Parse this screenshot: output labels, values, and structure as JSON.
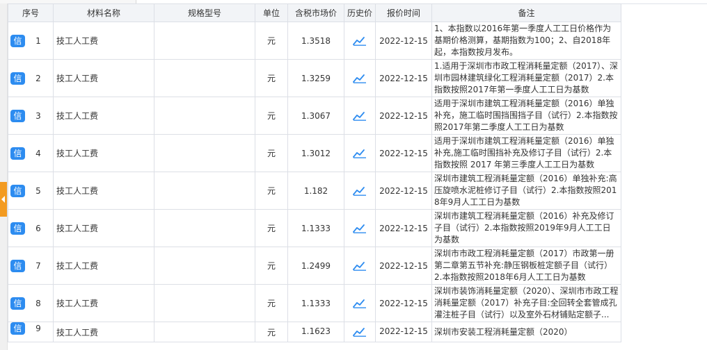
{
  "columns": [
    "序号",
    "材料名称",
    "规格型号",
    "单位",
    "含税市场价",
    "历史价",
    "报价时间",
    "备注"
  ],
  "badge_label": "信",
  "icon_color": "#2d8cf0",
  "rows": [
    {
      "seq": "1",
      "name": "技工人工费",
      "spec": "",
      "unit": "元",
      "price": "1.3518",
      "date": "2022-12-15",
      "note": "1、本指数以2016年第一季度人工工日价格作为基期价格测算，基期指数为100；2、自2018年起，本指数按月发布。"
    },
    {
      "seq": "2",
      "name": "技工人工费",
      "spec": "",
      "unit": "元",
      "price": "1.3259",
      "date": "2022-12-15",
      "note": "1.适用于深圳市市政工程消耗量定额（2017）、深圳市园林建筑绿化工程消耗量定额（2017）2.本指数按照2017年第一季度人工工日为基数"
    },
    {
      "seq": "3",
      "name": "技工人工费",
      "spec": "",
      "unit": "元",
      "price": "1.3067",
      "date": "2022-12-15",
      "note": "适用于深圳市建筑工程消耗量定额（2016）单独补充，施工临时围挡围挡子目（试行）2.本指数按照2017年第二季度人工工日为基数"
    },
    {
      "seq": "4",
      "name": "技工人工费",
      "spec": "",
      "unit": "元",
      "price": "1.3012",
      "date": "2022-12-15",
      "note": "适用于深圳市建筑工程消耗量定额（2016）单独补充,施工临时围挡补充及修订子目（试行）2.本指数按照 2017 年第三季度人工工日为基数"
    },
    {
      "seq": "5",
      "name": "技工人工费",
      "spec": "",
      "unit": "元",
      "price": "1.182",
      "date": "2022-12-15",
      "note": "深圳市建筑工程消耗量定额（2016）单独补充:高压旋喷水泥桩修订子目（试行）2.本指数按照2018年9月人工工日为基数"
    },
    {
      "seq": "6",
      "name": "技工人工费",
      "spec": "",
      "unit": "元",
      "price": "1.1333",
      "date": "2022-12-15",
      "note": "深圳市建筑工程消耗量定额（2016）补充及修订子目（试行）2.本指数按照2019年9月人工工日为基数"
    },
    {
      "seq": "7",
      "name": "技工人工费",
      "spec": "",
      "unit": "元",
      "price": "1.2499",
      "date": "2022-12-15",
      "note": "深圳市市政工程消耗量定额（2017）市政第一册第二章第五节补充:静压钢板桩定额子目（试行）2.本指数按照2018年6月人工工日为基数"
    },
    {
      "seq": "8",
      "name": "技工人工费",
      "spec": "",
      "unit": "元",
      "price": "1.1333",
      "date": "2022-12-15",
      "note": "深圳市装饰消耗量定额（2020）、深圳市市政工程消耗量定额（2017）补充子目:全回转全套管成孔灌注桩子目（试行）以及室外石材铺贴定额子..."
    },
    {
      "seq": "9",
      "name": "技工人工费",
      "spec": "",
      "unit": "元",
      "price": "1.1623",
      "date": "2022-12-15",
      "note": "深圳市安装工程消耗量定额（2020）"
    }
  ]
}
